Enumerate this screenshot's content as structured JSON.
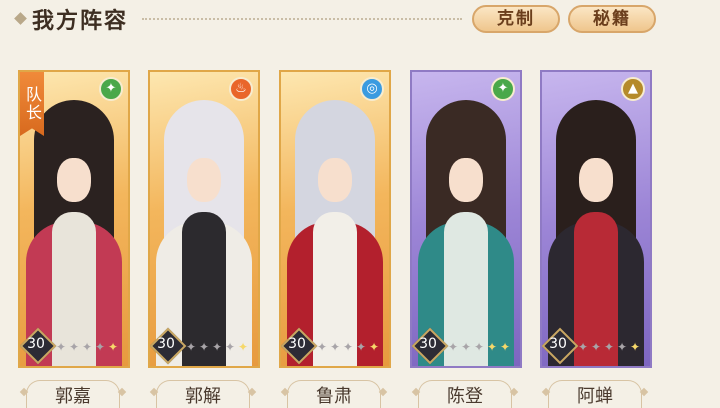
{
  "header": {
    "title": "我方阵容",
    "buttons": [
      "克制",
      "秘籍"
    ]
  },
  "captain_label": "队长",
  "colors": {
    "gold_frame": "#e79a3f",
    "purple_frame": "#8f7ac4",
    "star_on": "#f6d86a",
    "star_off": "#a8a4a8"
  },
  "heroes": [
    {
      "name": "郭嘉",
      "level": "30",
      "rarity": "gold",
      "element": "wind-icon",
      "element_glyph": "✦",
      "element_color": "#4aa84a",
      "stars_on": 1,
      "stars_total": 5,
      "captain": true
    },
    {
      "name": "郭解",
      "level": "30",
      "rarity": "gold",
      "element": "fire-icon",
      "element_glyph": "♨",
      "element_color": "#e9662a",
      "stars_on": 1,
      "stars_total": 5,
      "captain": false
    },
    {
      "name": "鲁肃",
      "level": "30",
      "rarity": "gold",
      "element": "water-icon",
      "element_glyph": "◎",
      "element_color": "#3a9be0",
      "stars_on": 1,
      "stars_total": 5,
      "captain": false
    },
    {
      "name": "陈登",
      "level": "30",
      "rarity": "purple",
      "element": "wind-icon",
      "element_glyph": "✦",
      "element_color": "#4aa84a",
      "stars_on": 2,
      "stars_total": 5,
      "captain": false
    },
    {
      "name": "阿蝉",
      "level": "30",
      "rarity": "purple",
      "element": "earth-icon",
      "element_glyph": "▲",
      "element_color": "#b58a2a",
      "stars_on": 1,
      "stars_total": 5,
      "captain": false
    }
  ]
}
